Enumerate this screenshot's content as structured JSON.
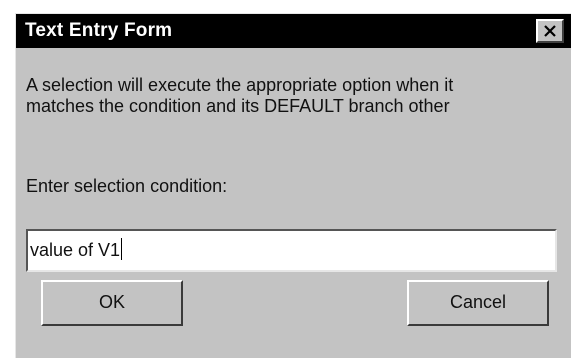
{
  "window": {
    "title": "Text Entry Form",
    "close_icon": "close-icon"
  },
  "message": {
    "line1": "A selection will execute the appropriate option when it",
    "line2": "matches the condition and its DEFAULT branch other"
  },
  "prompt": {
    "label": "Enter selection condition:"
  },
  "input": {
    "value": "value of V1"
  },
  "buttons": {
    "ok": "OK",
    "cancel": "Cancel"
  },
  "colors": {
    "titlebar": "#000000",
    "face": "#c3c3c3",
    "field": "#ffffff"
  }
}
